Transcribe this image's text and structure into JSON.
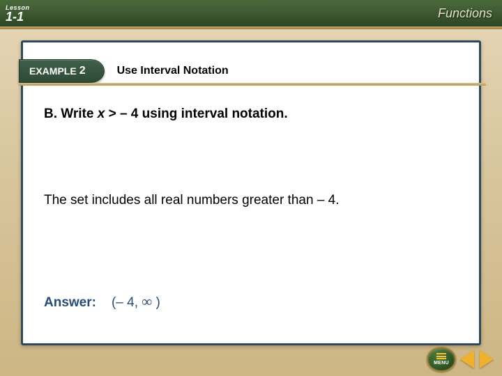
{
  "topbar": {
    "lesson_word": "Lesson",
    "lesson_number": "1-1",
    "chapter_title": "Functions"
  },
  "example": {
    "tab_word": "EXAMPLE",
    "tab_number": "2",
    "title": "Use Interval Notation"
  },
  "problem": {
    "prefix": "B. Write ",
    "variable": "x",
    "rest": " > – 4 using interval notation."
  },
  "explanation": "The set includes all real numbers greater than – 4.",
  "answer": {
    "label": "Answer:",
    "value_open": "(– 4, ",
    "value_infty": "∞",
    "value_close": " )"
  },
  "footer": {
    "menu_label": "MENU"
  }
}
